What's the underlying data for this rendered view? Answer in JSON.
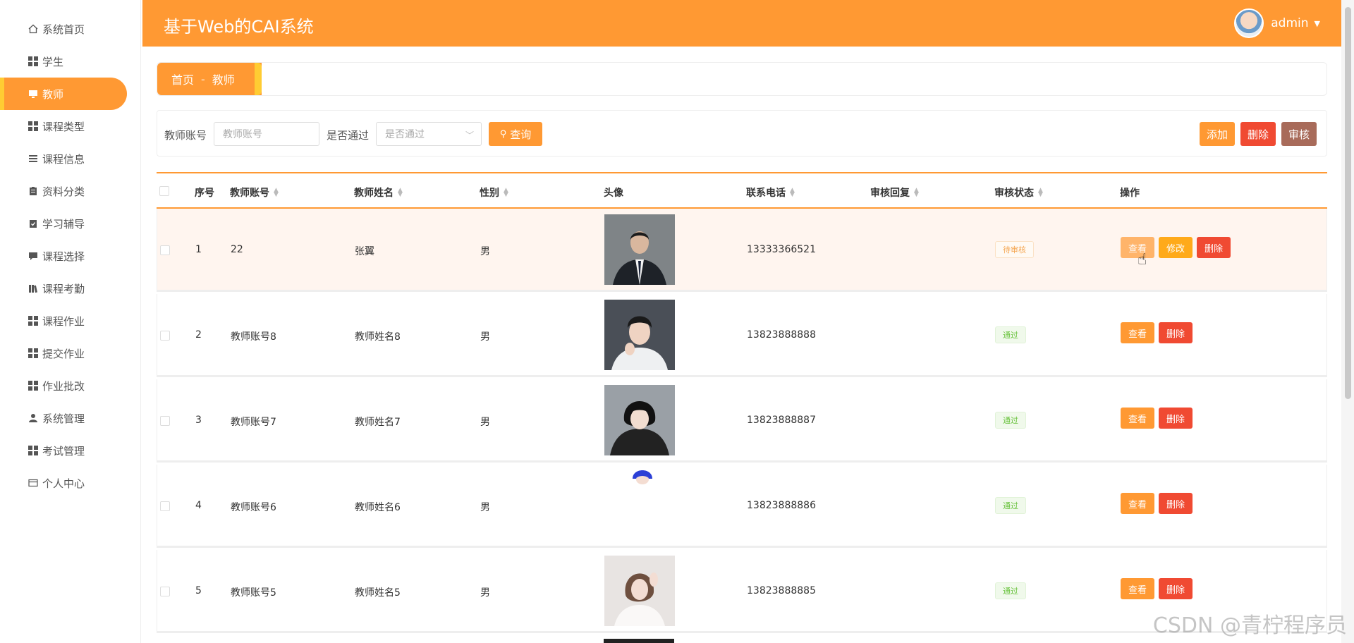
{
  "app": {
    "title": "基于Web的CAI系统"
  },
  "user": {
    "name": "admin"
  },
  "sidebar": {
    "items": [
      {
        "label": "系统首页",
        "icon": "home-icon"
      },
      {
        "label": "学生",
        "icon": "grid-icon"
      },
      {
        "label": "教师",
        "icon": "monitor-icon",
        "active": true
      },
      {
        "label": "课程类型",
        "icon": "grid-icon"
      },
      {
        "label": "课程信息",
        "icon": "list-icon"
      },
      {
        "label": "资料分类",
        "icon": "clipboard-icon"
      },
      {
        "label": "学习辅导",
        "icon": "clipboard-check-icon"
      },
      {
        "label": "课程选择",
        "icon": "chat-icon"
      },
      {
        "label": "课程考勤",
        "icon": "books-icon"
      },
      {
        "label": "课程作业",
        "icon": "grid-icon"
      },
      {
        "label": "提交作业",
        "icon": "grid-icon"
      },
      {
        "label": "作业批改",
        "icon": "grid-icon"
      },
      {
        "label": "系统管理",
        "icon": "user-icon"
      },
      {
        "label": "考试管理",
        "icon": "grid-icon"
      },
      {
        "label": "个人中心",
        "icon": "card-icon"
      }
    ]
  },
  "breadcrumb": {
    "home": "首页",
    "sep": "-",
    "current": "教师"
  },
  "search": {
    "account_label": "教师账号",
    "account_placeholder": "教师账号",
    "passed_label": "是否通过",
    "passed_placeholder": "是否通过",
    "query_button": "查询"
  },
  "toolbar": {
    "add": "添加",
    "delete": "删除",
    "review": "审核"
  },
  "table": {
    "headers": {
      "index": "序号",
      "account": "教师账号",
      "name": "教师姓名",
      "gender": "性别",
      "avatar": "头像",
      "phone": "联系电话",
      "reply": "审核回复",
      "status": "审核状态",
      "actions": "操作"
    },
    "rows": [
      {
        "index": "1",
        "account": "22",
        "name": "张翼",
        "gender": "男",
        "phone": "13333366521",
        "reply": "",
        "status": "待审核",
        "status_type": "pending"
      },
      {
        "index": "2",
        "account": "教师账号8",
        "name": "教师姓名8",
        "gender": "男",
        "phone": "13823888888",
        "reply": "",
        "status": "通过",
        "status_type": "pass"
      },
      {
        "index": "3",
        "account": "教师账号7",
        "name": "教师姓名7",
        "gender": "男",
        "phone": "13823888887",
        "reply": "",
        "status": "通过",
        "status_type": "pass"
      },
      {
        "index": "4",
        "account": "教师账号6",
        "name": "教师姓名6",
        "gender": "男",
        "phone": "13823888886",
        "reply": "",
        "status": "通过",
        "status_type": "pass"
      },
      {
        "index": "5",
        "account": "教师账号5",
        "name": "教师姓名5",
        "gender": "男",
        "phone": "13823888885",
        "reply": "",
        "status": "通过",
        "status_type": "pass"
      }
    ],
    "row_actions": {
      "view": "查看",
      "edit": "修改",
      "delete": "删除"
    }
  },
  "watermark": "CSDN @青柠程序员",
  "colors": {
    "primary": "#ff9933",
    "accent": "#ffcc33",
    "danger": "#f04a32",
    "review": "#a86b5a"
  }
}
